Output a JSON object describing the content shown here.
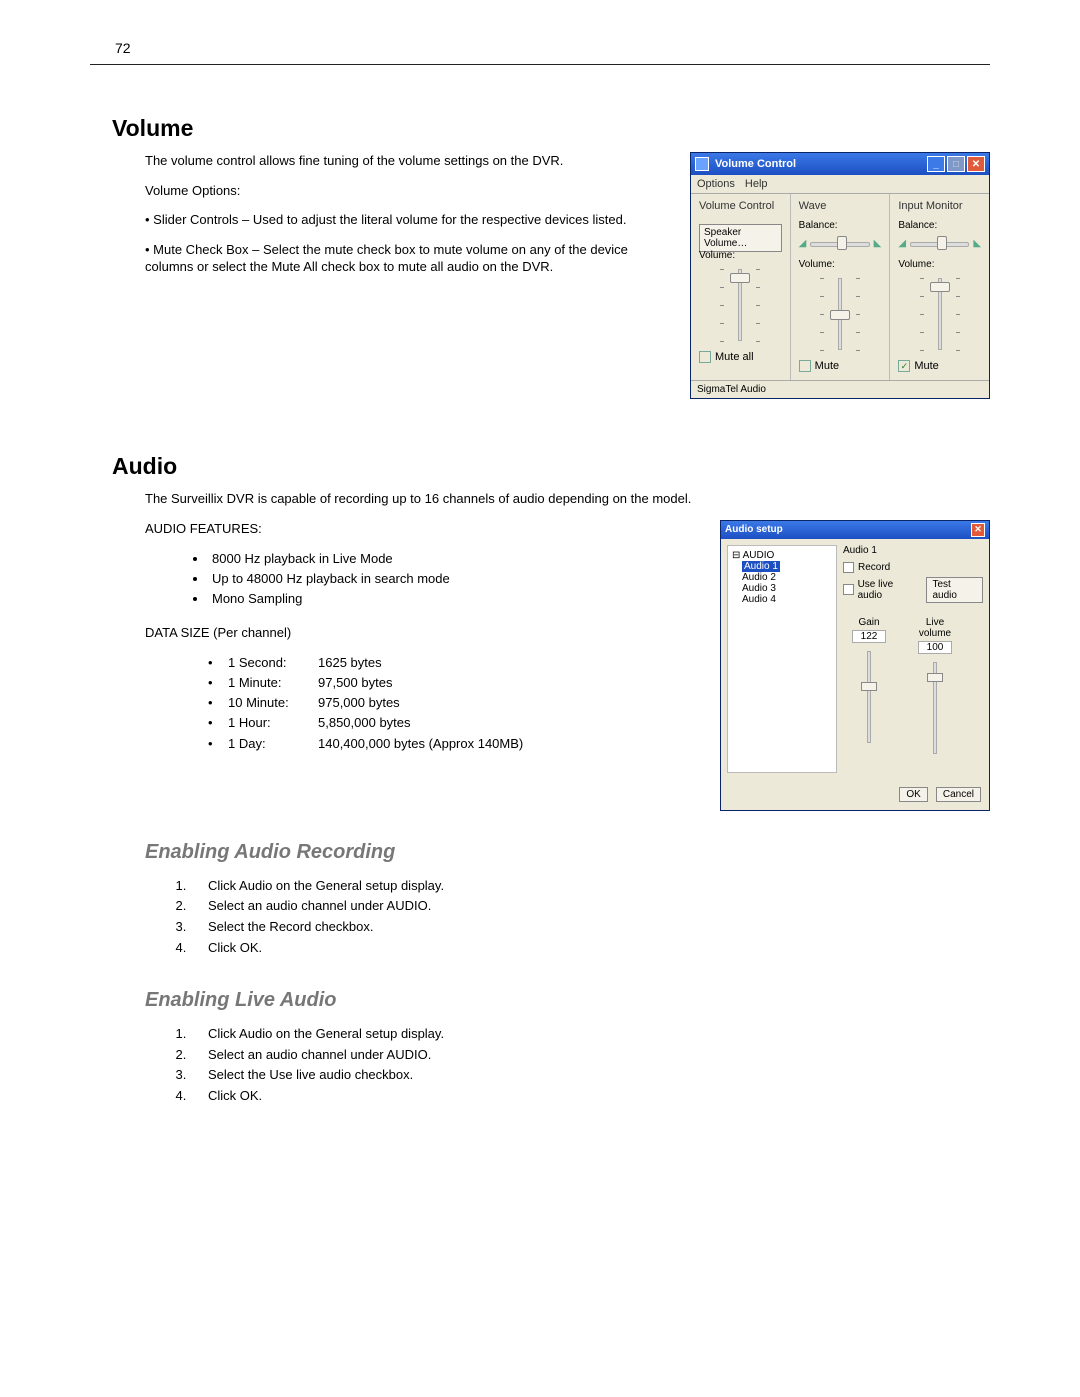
{
  "page_number": "72",
  "volume_section": {
    "title": "Volume",
    "intro": "The volume control allows fine tuning of the volume settings on the DVR.",
    "options_label": "Volume Options:",
    "options": [
      "• Slider Controls – Used to adjust the literal volume for the respective devices listed.",
      "• Mute Check Box – Select the mute check box to mute volume on any of the device columns or select the Mute All check box to mute all audio on the DVR."
    ]
  },
  "volume_window": {
    "title": "Volume Control",
    "menu": [
      "Options",
      "Help"
    ],
    "columns": [
      {
        "title": "Volume Control",
        "balance_label": "",
        "has_speaker_btn": true,
        "speaker_btn": "Speaker Volume…",
        "volume_label": "Volume:",
        "mute_label": "Mute all",
        "mute_checked": false,
        "thumb_pct": 10
      },
      {
        "title": "Wave",
        "balance_label": "Balance:",
        "volume_label": "Volume:",
        "mute_label": "Mute",
        "mute_checked": false,
        "thumb_pct": 45
      },
      {
        "title": "Input Monitor",
        "balance_label": "Balance:",
        "volume_label": "Volume:",
        "mute_label": "Mute",
        "mute_checked": true,
        "thumb_pct": 10
      }
    ],
    "status": "SigmaTel Audio"
  },
  "audio_section": {
    "title": "Audio",
    "intro": "The Surveillix DVR is capable of recording up to 16 channels of audio depending on the model.",
    "features_label": "AUDIO FEATURES:",
    "features": [
      "8000 Hz playback in Live Mode",
      "Up to 48000 Hz playback in search mode",
      "Mono Sampling"
    ],
    "data_size_label": "DATA SIZE (Per channel)",
    "data_size": [
      {
        "label": "1 Second:",
        "value": "1625 bytes"
      },
      {
        "label": "1 Minute:",
        "value": "97,500 bytes"
      },
      {
        "label": "10 Minute:",
        "value": "975,000 bytes"
      },
      {
        "label": "1 Hour:",
        "value": "5,850,000 bytes"
      },
      {
        "label": "1 Day:",
        "value": "140,400,000 bytes (Approx 140MB)"
      }
    ]
  },
  "audio_window": {
    "title": "Audio setup",
    "tree_root": "AUDIO",
    "tree_items": [
      "Audio 1",
      "Audio 2",
      "Audio 3",
      "Audio 4"
    ],
    "tree_selected": "Audio 1",
    "group_title": "Audio 1",
    "record_label": "Record",
    "live_audio_label": "Use live audio",
    "test_audio_btn": "Test audio",
    "gain_label": "Gain",
    "gain_value": "122",
    "gain_thumb_pct": 35,
    "live_vol_label": "Live volume",
    "live_vol_value": "100",
    "live_vol_thumb_pct": 15,
    "ok_btn": "OK",
    "cancel_btn": "Cancel"
  },
  "enable_recording": {
    "title": "Enabling Audio Recording",
    "steps": [
      "Click Audio on the General setup display.",
      "Select an audio channel under AUDIO.",
      "Select the Record checkbox.",
      "Click OK."
    ]
  },
  "enable_live": {
    "title": "Enabling Live Audio",
    "steps": [
      "Click Audio on the General setup display.",
      "Select an audio channel under AUDIO.",
      "Select the Use live audio checkbox.",
      "Click OK."
    ]
  }
}
